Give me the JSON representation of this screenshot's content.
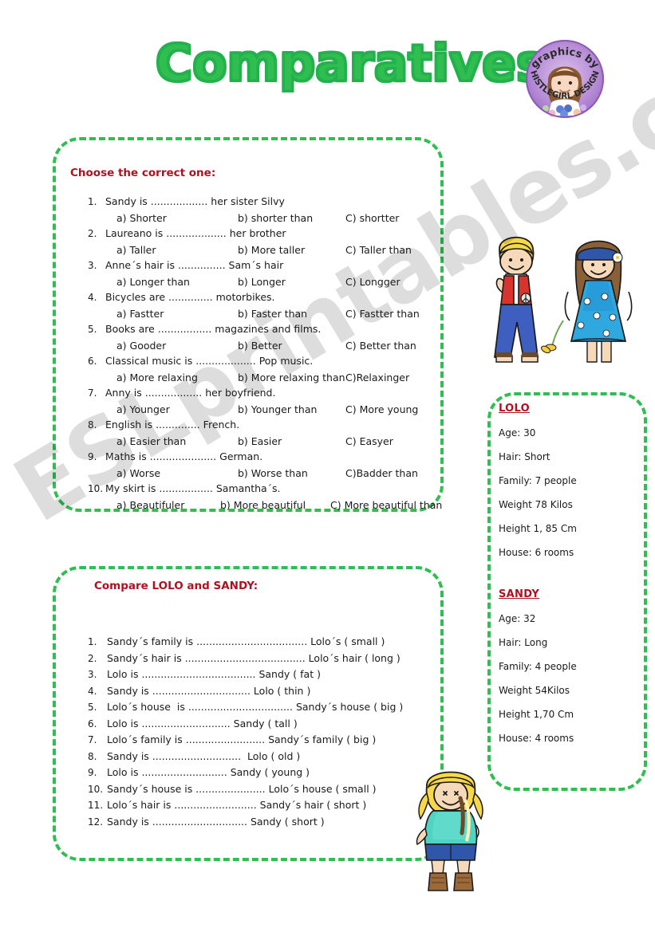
{
  "title": "Comparatives",
  "watermark": "ESLprintables.com",
  "logo": {
    "top_text": "graphics by",
    "bottom_text": "THISTLEGIRL DESIGNS",
    "name": "thistlegirl-designs-logo"
  },
  "exercise1": {
    "heading": "Choose the correct one:",
    "questions": [
      {
        "num": "1.",
        "stem": "Sandy is .................. her sister Silvy",
        "a": "a)   Shorter",
        "b": "b) shorter than",
        "c": "C) shortter"
      },
      {
        "num": "2.",
        "stem": "Laureano is ................... her brother",
        "a": "a)   Taller",
        "b": "b) More taller",
        "c": "C) Taller than"
      },
      {
        "num": "3.",
        "stem": "Anne´s hair is ............... Sam´s hair",
        "a": "a)   Longer than",
        "b": "b) Longer",
        "c": "C) Longger"
      },
      {
        "num": "4.",
        "stem": "Bicycles are .............. motorbikes.",
        "a": "a)   Fastter",
        "b": "b) Faster than",
        "c": "C) Fastter than"
      },
      {
        "num": "5.",
        "stem": "Books are ................. magazines and films.",
        "a": "a)   Gooder",
        "b": "b) Better",
        "c": "C) Better than"
      },
      {
        "num": "6.",
        "stem": "Classical music is ................... Pop music.",
        "a": "a)   More relaxing",
        "b": "b) More relaxing than",
        "c": "C)Relaxinger"
      },
      {
        "num": "7.",
        "stem": "Anny is .................. her boyfriend.",
        "a": "a)   Younger",
        "b": "b) Younger than",
        "c": "C) More young"
      },
      {
        "num": "8.",
        "stem": "English is .............. French.",
        "a": "a)   Easier than",
        "b": "b) Easier",
        "c": "C) Easyer"
      },
      {
        "num": "9.",
        "stem": "Maths is ..................... German.",
        "a": "a)   Worse",
        "b": "b) Worse than",
        "c": "C)Badder than"
      },
      {
        "num": "10.",
        "stem": "My skirt is ................. Samantha´s.",
        "a": "a)   Beautifuler",
        "b": "b) More beautiful",
        "c": "C) More beautiful than"
      }
    ]
  },
  "exercise2": {
    "heading": "Compare LOLO and SANDY:",
    "items": [
      {
        "num": "1.",
        "text": "Sandy´s family is ................................... Lolo´s ( small )"
      },
      {
        "num": "2.",
        "text": "Sandy´s hair is ...................................... Lolo´s hair ( long )"
      },
      {
        "num": "3.",
        "text": "Lolo is .................................... Sandy ( fat )"
      },
      {
        "num": "4.",
        "text": "Sandy is ............................... Lolo ( thin )"
      },
      {
        "num": "5.",
        "text": "Lolo´s house  is ................................. Sandy´s house ( big )"
      },
      {
        "num": "6.",
        "text": "Lolo is ............................ Sandy ( tall )"
      },
      {
        "num": "7.",
        "text": "Lolo´s family is ......................... Sandy´s family ( big )"
      },
      {
        "num": "8.",
        "text": "Sandy is ............................  Lolo ( old )"
      },
      {
        "num": "9.",
        "text": "Lolo is ........................... Sandy ( young )"
      },
      {
        "num": "10.",
        "text": "Sandy´s house is ...................... Lolo´s house ( small )"
      },
      {
        "num": "11.",
        "text": "Lolo´s hair is .......................... Sandy´s hair ( short )"
      },
      {
        "num": "12.",
        "text": "Sandy is .............................. Sandy ( short )"
      }
    ]
  },
  "profiles": [
    {
      "name": "LOLO",
      "lines": [
        "Age: 30",
        "Hair: Short",
        "Family:  7 people",
        "Weight 78 Kilos",
        "Height 1, 85 Cm",
        "House: 6 rooms"
      ]
    },
    {
      "name": "SANDY",
      "lines": [
        "Age: 32",
        "Hair: Long",
        "Family: 4 people",
        "Weight 54Kilos",
        "Height 1,70 Cm",
        "House: 4 rooms"
      ]
    }
  ],
  "colors": {
    "title_green": "#2fbe4f",
    "border_green": "#2fbe4f",
    "heading_red": "#b01020",
    "body_black": "#1a1a1a",
    "logo_purple": "#b48bd4"
  },
  "clipart": {
    "pair": "hippie-boy-and-girl-illustration",
    "girl": "blonde-girl-with-braids-illustration"
  }
}
